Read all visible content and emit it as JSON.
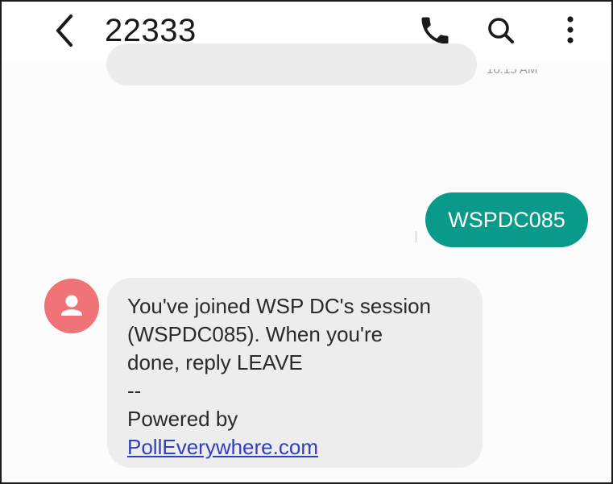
{
  "header": {
    "contact_name": "22333",
    "icons": {
      "back": "back-chevron-icon",
      "call": "phone-icon",
      "search": "search-icon",
      "more": "more-vertical-icon"
    }
  },
  "previous_message": {
    "time": "10:15 AM"
  },
  "outgoing_message": {
    "text": "WSPDC085",
    "bubble_color": "#0a9a8a"
  },
  "incoming_message": {
    "avatar_icon": "person-icon",
    "avatar_color": "#ef7377",
    "lines": [
      "You've joined WSP DC's session",
      "(WSPDC085). When you're",
      "done, reply LEAVE",
      "--",
      "Powered by"
    ],
    "link_text": "PollEverywhere.com"
  }
}
